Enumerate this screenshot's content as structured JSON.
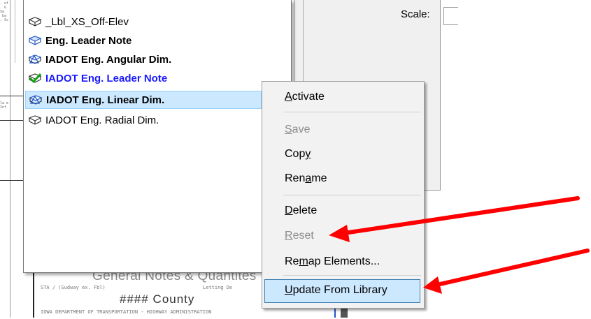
{
  "list": {
    "items": [
      {
        "label": "_Lbl_XS_Off-Elev",
        "icon": "text-style-icon",
        "style": "normal"
      },
      {
        "label": "Eng. Leader Note",
        "icon": "text-style-icon",
        "style": "bold"
      },
      {
        "label": "IADOT Eng. Angular Dim.",
        "icon": "dimension-style-icon",
        "style": "bold"
      },
      {
        "label": "IADOT Eng. Leader Note",
        "icon": "active-checkmark-icon",
        "style": "active"
      },
      {
        "label": "IADOT Eng. Linear Dim.",
        "icon": "dimension-style-icon",
        "style": "selected"
      },
      {
        "label": "IADOT Eng. Radial Dim.",
        "icon": "text-style-icon",
        "style": "normal"
      }
    ]
  },
  "settings": {
    "scale_label": "Scale:"
  },
  "context_menu": {
    "activate": {
      "pre": "",
      "key": "A",
      "post": "ctivate"
    },
    "save": {
      "pre": "",
      "key": "S",
      "post": "ave"
    },
    "copy": {
      "pre": "Cop",
      "key": "y",
      "post": ""
    },
    "rename": {
      "pre": "Ren",
      "key": "a",
      "post": "me"
    },
    "delete": {
      "pre": "",
      "key": "D",
      "post": "elete"
    },
    "reset": {
      "pre": "",
      "key": "R",
      "post": "eset"
    },
    "remap": {
      "pre": "Re",
      "key": "m",
      "post": "ap Elements..."
    },
    "update": {
      "pre": "",
      "key": "U",
      "post": "pdate From Library"
    }
  },
  "drawing": {
    "title": "General Notes & Quantites",
    "sub_left": "STA / (Sudway ex. Fbl)",
    "sub_right": "Letting De",
    "county": "#### County",
    "footer": "IOWA DEPARTMENT OF TRANSPORTATION - HIGHWAY ADMINISTRATION"
  },
  "colors": {
    "annotation_arrow": "#ff0000",
    "selection": "#cce8ff",
    "active_text": "#1a1aff"
  }
}
